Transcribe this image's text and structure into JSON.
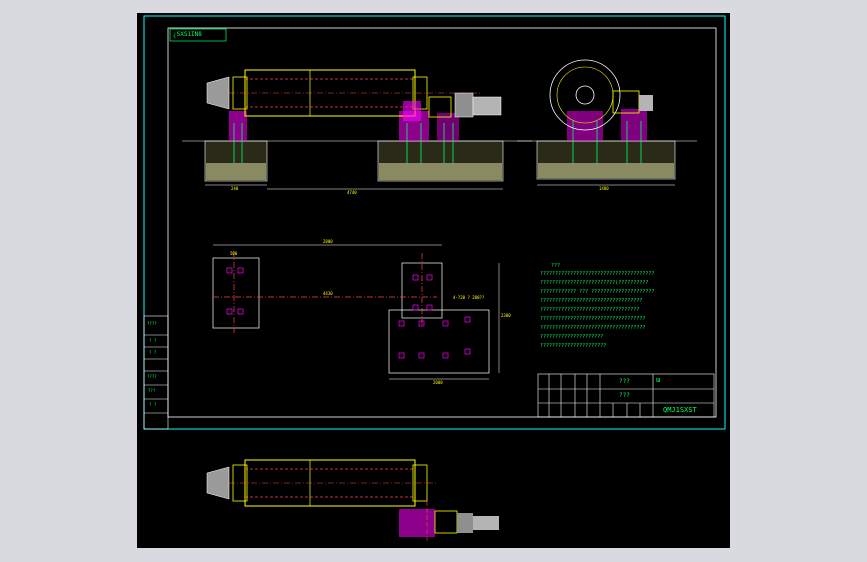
{
  "drawing": {
    "sheet_tag": "¿SXS1IN8",
    "tech_title": "???",
    "tech_lines": [
      "??????????????????????????????????????",
      "?????????????????????????(??????????",
      "???????????? ??? ?????????????????????",
      "??????????????????????????????????",
      "?????????????????????????????????",
      "???????????????????????????????????",
      "???????????????????????????????????",
      "?????????????????????",
      "??????????????????????"
    ],
    "title_block": {
      "name": "???",
      "scale_mark": "ɯ",
      "unit": "???",
      "drawing_no": "QMJ1SXST"
    },
    "left_column_labels": [
      "????",
      "? ?",
      "? ?",
      "????",
      "???",
      "? ?"
    ],
    "dims": {
      "elev_left": "240",
      "elev_total": "4740",
      "elev_right": "1480",
      "plan_total": "2800",
      "plan_top_left": "500",
      "plan_mid": "4430",
      "plan_callout": "4-?20 ? 280??",
      "plan_bottom": "2000",
      "plan_height": "2380"
    }
  },
  "colors": {
    "frame": "#00ffff",
    "geometry": "#ffff00",
    "accent": "#ff00ff",
    "motor": "#b4b4b4",
    "notes": "#00ff66",
    "foundation": "#d8d8a0"
  }
}
